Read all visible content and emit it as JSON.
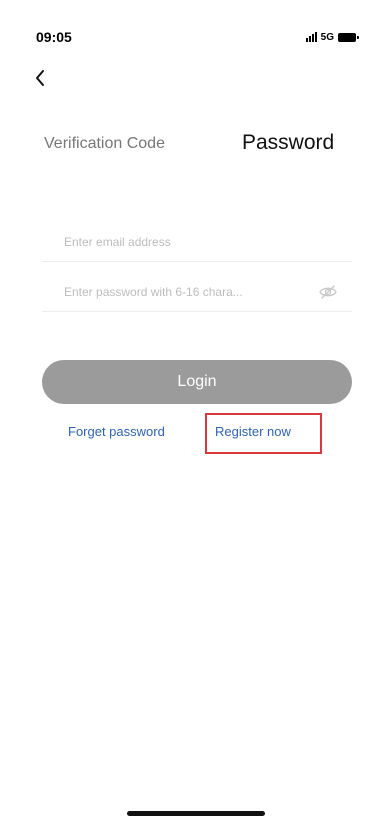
{
  "status_bar": {
    "time": "09:05",
    "network": "5G",
    "icons": [
      "signal-icon",
      "battery-icon"
    ]
  },
  "header": {
    "back_icon": "chevron-left-icon"
  },
  "tabs": [
    {
      "label": "Verification Code",
      "active": false
    },
    {
      "label": "Password",
      "active": true
    }
  ],
  "form": {
    "email_placeholder": "Enter email address",
    "email_value": "",
    "password_placeholder": "Enter password with 6-16 chara...",
    "password_value": "",
    "eye_icon": "eye-off-icon"
  },
  "actions": {
    "login_label": "Login",
    "forget_password_label": "Forget password",
    "register_label": "Register now"
  },
  "colors": {
    "login_button": "#9b9b9b",
    "link": "#2f64b3",
    "highlight_box": "#d9393d"
  }
}
